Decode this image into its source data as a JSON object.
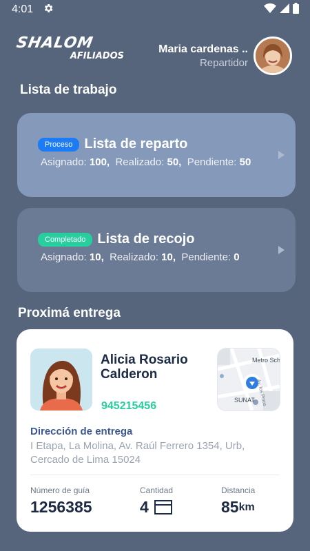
{
  "status_bar": {
    "time": "4:01"
  },
  "brand": {
    "name": "SHALOM",
    "subtitle": "AFILIADOS"
  },
  "user": {
    "name": "Maria cardenas ..",
    "role": "Repartidor"
  },
  "work_list": {
    "title": "Lista de trabajo",
    "cards": [
      {
        "badge": "Proceso",
        "badge_color": "#1e7bf6",
        "title": "Lista de reparto",
        "assigned_label": "Asignado:",
        "assigned": "100,",
        "done_label": "Realizado:",
        "done": "50,",
        "pending_label": "Pendiente:",
        "pending": "50"
      },
      {
        "badge": "Completado",
        "badge_color": "#27cf9f",
        "title": "Lista de recojo",
        "assigned_label": "Asignado:",
        "assigned": "10,",
        "done_label": "Realizado:",
        "done": "10,",
        "pending_label": "Pendiente:",
        "pending": "0"
      }
    ]
  },
  "next_delivery": {
    "title": "Proximá entrega",
    "client_name": "Alicia Rosario Calderon",
    "client_phone": "945215456",
    "map_labels": {
      "metro": "Metro Sch",
      "street": "Av. los Pinos",
      "sunat": "SUNAT"
    },
    "address_label": "Dirección de entrega",
    "address": "I Etapa, La Molina, Av. Raúl Ferrero 1354, Urb, Cercado de Lima 15024",
    "guide_label": "Número de guía",
    "guide_value": "1256385",
    "qty_label": "Cantidad",
    "qty_value": "4",
    "dist_label": "Distancia",
    "dist_value": "85",
    "dist_unit": "km"
  }
}
